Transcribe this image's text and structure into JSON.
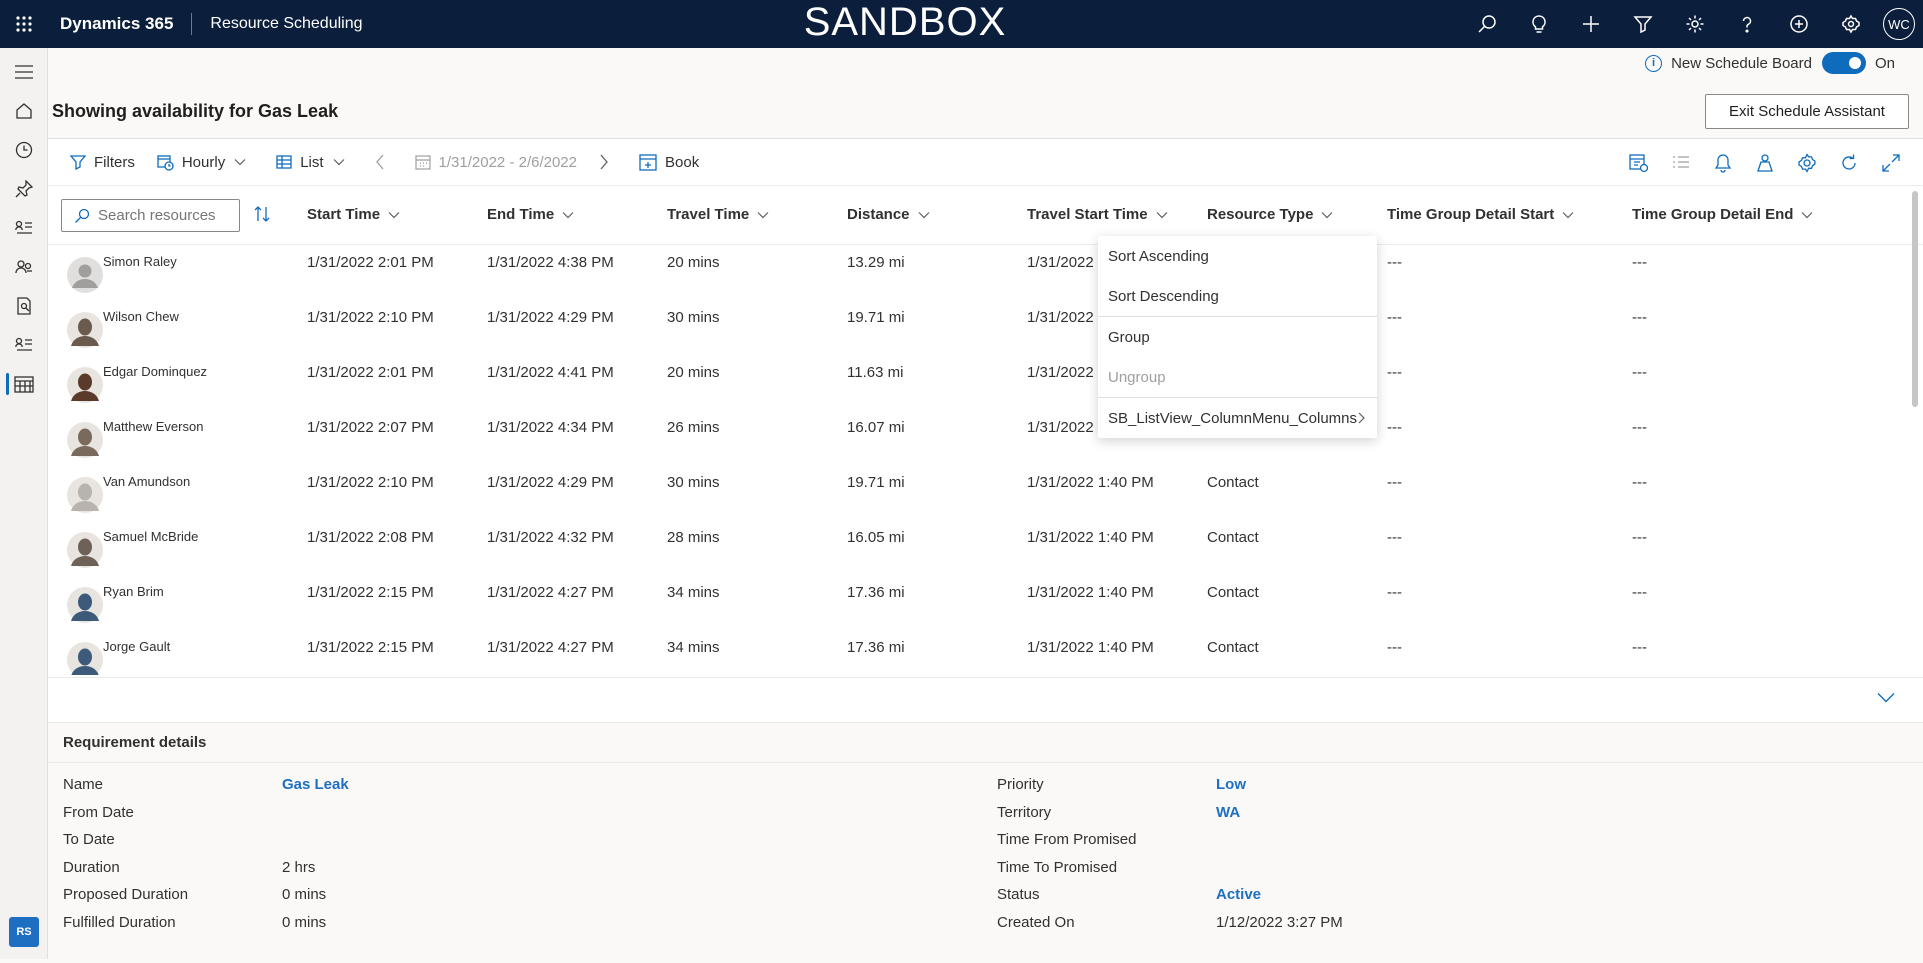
{
  "topbar": {
    "brand": "Dynamics 365",
    "app_name": "Resource Scheduling",
    "environment": "SANDBOX",
    "user_initials": "WC"
  },
  "header": {
    "new_board_label": "New Schedule Board",
    "new_board_state": "On",
    "title": "Showing availability for Gas Leak",
    "exit_button": "Exit Schedule Assistant"
  },
  "toolbar": {
    "filters": "Filters",
    "hourly": "Hourly",
    "list": "List",
    "date_range": "1/31/2022 - 2/6/2022",
    "book": "Book"
  },
  "search": {
    "placeholder": "Search resources"
  },
  "columns": [
    "Start Time",
    "End Time",
    "Travel Time",
    "Distance",
    "Travel Start Time",
    "Resource Type",
    "Time Group Detail Start",
    "Time Group Detail End"
  ],
  "rows": [
    {
      "name": "Simon Raley",
      "start": "1/31/2022 2:01 PM",
      "end": "1/31/2022 4:38 PM",
      "travel": "20 mins",
      "distance": "13.29 mi",
      "travel_start": "1/31/2022",
      "type": "",
      "tg_start": "---",
      "tg_end": "---",
      "avatar_color": "#c8c6c4"
    },
    {
      "name": "Wilson Chew",
      "start": "1/31/2022 2:10 PM",
      "end": "1/31/2022 4:29 PM",
      "travel": "30 mins",
      "distance": "19.71 mi",
      "travel_start": "1/31/2022",
      "type": "",
      "tg_start": "---",
      "tg_end": "---",
      "avatar_color": "#6b5a4e"
    },
    {
      "name": "Edgar Dominquez",
      "start": "1/31/2022 2:01 PM",
      "end": "1/31/2022 4:41 PM",
      "travel": "20 mins",
      "distance": "11.63 mi",
      "travel_start": "1/31/2022",
      "type": "",
      "tg_start": "---",
      "tg_end": "---",
      "avatar_color": "#5a3a2a"
    },
    {
      "name": "Matthew Everson",
      "start": "1/31/2022 2:07 PM",
      "end": "1/31/2022 4:34 PM",
      "travel": "26 mins",
      "distance": "16.07 mi",
      "travel_start": "1/31/2022",
      "type": "",
      "tg_start": "---",
      "tg_end": "---",
      "avatar_color": "#7a6a5e"
    },
    {
      "name": "Van Amundson",
      "start": "1/31/2022 2:10 PM",
      "end": "1/31/2022 4:29 PM",
      "travel": "30 mins",
      "distance": "19.71 mi",
      "travel_start": "1/31/2022 1:40 PM",
      "type": "Contact",
      "tg_start": "---",
      "tg_end": "---",
      "avatar_color": "#b9b3ad"
    },
    {
      "name": "Samuel McBride",
      "start": "1/31/2022 2:08 PM",
      "end": "1/31/2022 4:32 PM",
      "travel": "28 mins",
      "distance": "16.05 mi",
      "travel_start": "1/31/2022 1:40 PM",
      "type": "Contact",
      "tg_start": "---",
      "tg_end": "---",
      "avatar_color": "#6e6258"
    },
    {
      "name": "Ryan Brim",
      "start": "1/31/2022 2:15 PM",
      "end": "1/31/2022 4:27 PM",
      "travel": "34 mins",
      "distance": "17.36 mi",
      "travel_start": "1/31/2022 1:40 PM",
      "type": "Contact",
      "tg_start": "---",
      "tg_end": "---",
      "avatar_color": "#3d5a7a"
    },
    {
      "name": "Jorge Gault",
      "start": "1/31/2022 2:15 PM",
      "end": "1/31/2022 4:27 PM",
      "travel": "34 mins",
      "distance": "17.36 mi",
      "travel_start": "1/31/2022 1:40 PM",
      "type": "Contact",
      "tg_start": "---",
      "tg_end": "---",
      "avatar_color": "#3d5a7a"
    }
  ],
  "context_menu": {
    "sort_asc": "Sort Ascending",
    "sort_desc": "Sort Descending",
    "group": "Group",
    "ungroup": "Ungroup",
    "columns": "SB_ListView_ColumnMenu_Columns"
  },
  "requirement": {
    "title": "Requirement details",
    "left": [
      {
        "label": "Name",
        "value": "Gas Leak",
        "link": true
      },
      {
        "label": "From Date",
        "value": ""
      },
      {
        "label": "To Date",
        "value": ""
      },
      {
        "label": "Duration",
        "value": "2 hrs"
      },
      {
        "label": "Proposed Duration",
        "value": "0 mins"
      },
      {
        "label": "Fulfilled Duration",
        "value": "0 mins"
      }
    ],
    "right": [
      {
        "label": "Priority",
        "value": "Low",
        "link": true
      },
      {
        "label": "Territory",
        "value": "WA",
        "link": true
      },
      {
        "label": "Time From Promised",
        "value": ""
      },
      {
        "label": "Time To Promised",
        "value": ""
      },
      {
        "label": "Status",
        "value": "Active",
        "link": true
      },
      {
        "label": "Created On",
        "value": "1/12/2022 3:27 PM"
      }
    ]
  },
  "colors": {
    "topbar": "#0b1e3c",
    "accent": "#0f6cbd",
    "link": "#1e6fc2"
  }
}
